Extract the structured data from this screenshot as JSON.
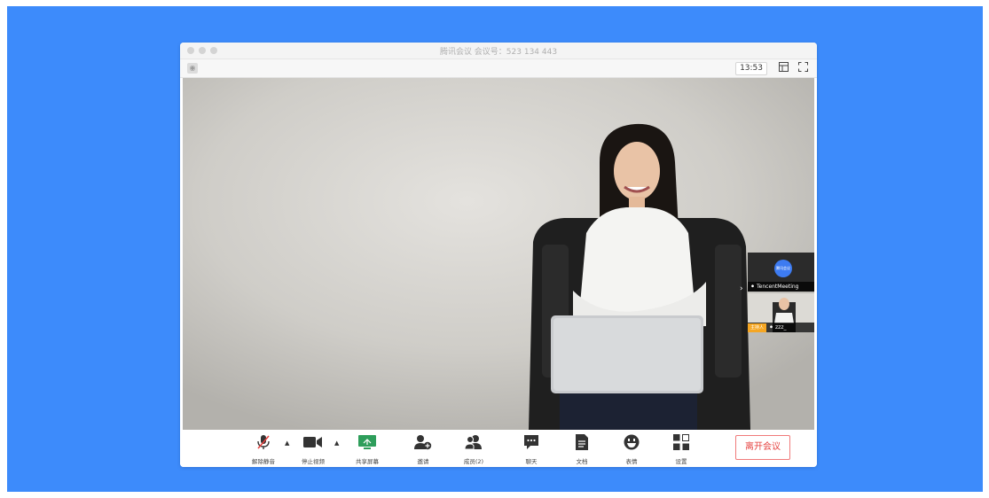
{
  "window": {
    "title": "腾讯会议 会议号：523 134 443"
  },
  "topbar": {
    "timer": "13:53"
  },
  "participants": [
    {
      "name": "TencentMeeting",
      "logo_text": "腾讯会议"
    },
    {
      "name": "zzz_",
      "role_badge": "主持人"
    }
  ],
  "toolbar": {
    "unmute_label": "解除静音",
    "stop_video_label": "停止视频",
    "share_label": "共享屏幕",
    "invite_label": "邀请",
    "members_label": "成员(2)",
    "chat_label": "聊天",
    "docs_label": "文档",
    "emoji_label": "表情",
    "settings_label": "设置",
    "leave_label": "离开会议"
  },
  "colors": {
    "background": "#3d8bfb",
    "leave": "#e64340",
    "host_badge": "#f5a623",
    "share": "#2e9e5b"
  },
  "icons": [
    "muted-mic-icon",
    "video-camera-icon",
    "share-screen-icon",
    "invite-icon",
    "members-icon",
    "chat-icon",
    "document-icon",
    "emoji-icon",
    "settings-icon",
    "fullscreen-icon",
    "layout-icon",
    "security-icon"
  ]
}
